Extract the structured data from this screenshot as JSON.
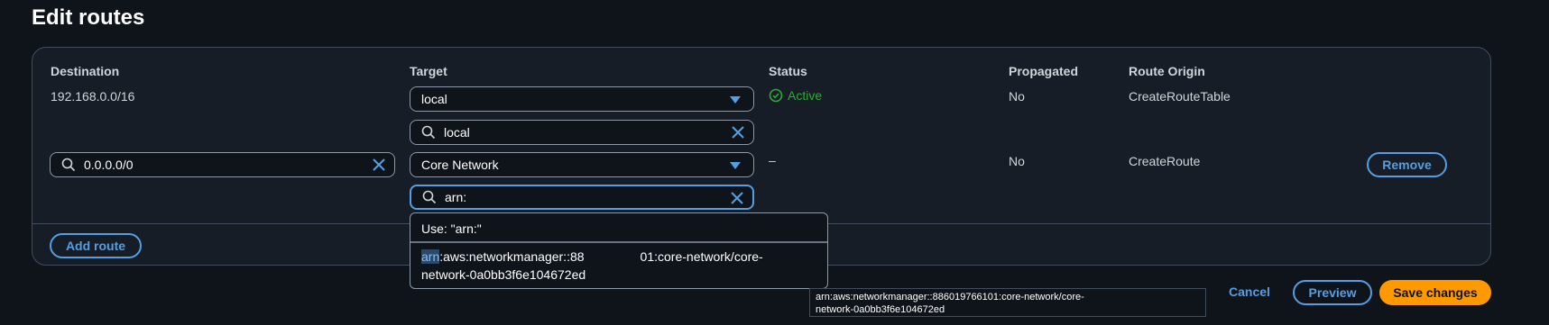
{
  "page": {
    "title": "Edit routes"
  },
  "columns": {
    "destination": "Destination",
    "target": "Target",
    "status": "Status",
    "propagated": "Propagated",
    "route_origin": "Route Origin"
  },
  "rows": [
    {
      "destination": "192.168.0.0/16",
      "target_select": "local",
      "target_search": "local",
      "status": "Active",
      "propagated": "No",
      "route_origin": "CreateRouteTable"
    },
    {
      "destination_search": "0.0.0.0/0",
      "target_select": "Core Network",
      "target_search": "arn:",
      "status": "–",
      "propagated": "No",
      "route_origin": "CreateRoute",
      "remove_label": "Remove"
    }
  ],
  "add_route_label": "Add route",
  "dropdown": {
    "use_text": "Use: \"arn:\"",
    "option_highlight": "arn",
    "option_part1": ":aws:networkmanager::88",
    "option_part2": "01:core-network/core-",
    "option_part3": "network-0a0bb3f6e104672ed"
  },
  "tooltip": {
    "line1": "arn:aws:networkmanager::886019766101:core-network/core-",
    "line2": "network-0a0bb3f6e104672ed"
  },
  "footer": {
    "cancel_label": "Cancel",
    "preview_label": "Preview",
    "save_label": "Save changes"
  },
  "colors": {
    "background": "#0f141a",
    "panel": "#161d26",
    "accent": "#539fe5",
    "primary": "#ff9900",
    "success": "#29ad32"
  },
  "icons": [
    "search-icon",
    "clear-icon",
    "caret-down-icon",
    "status-success-icon"
  ]
}
